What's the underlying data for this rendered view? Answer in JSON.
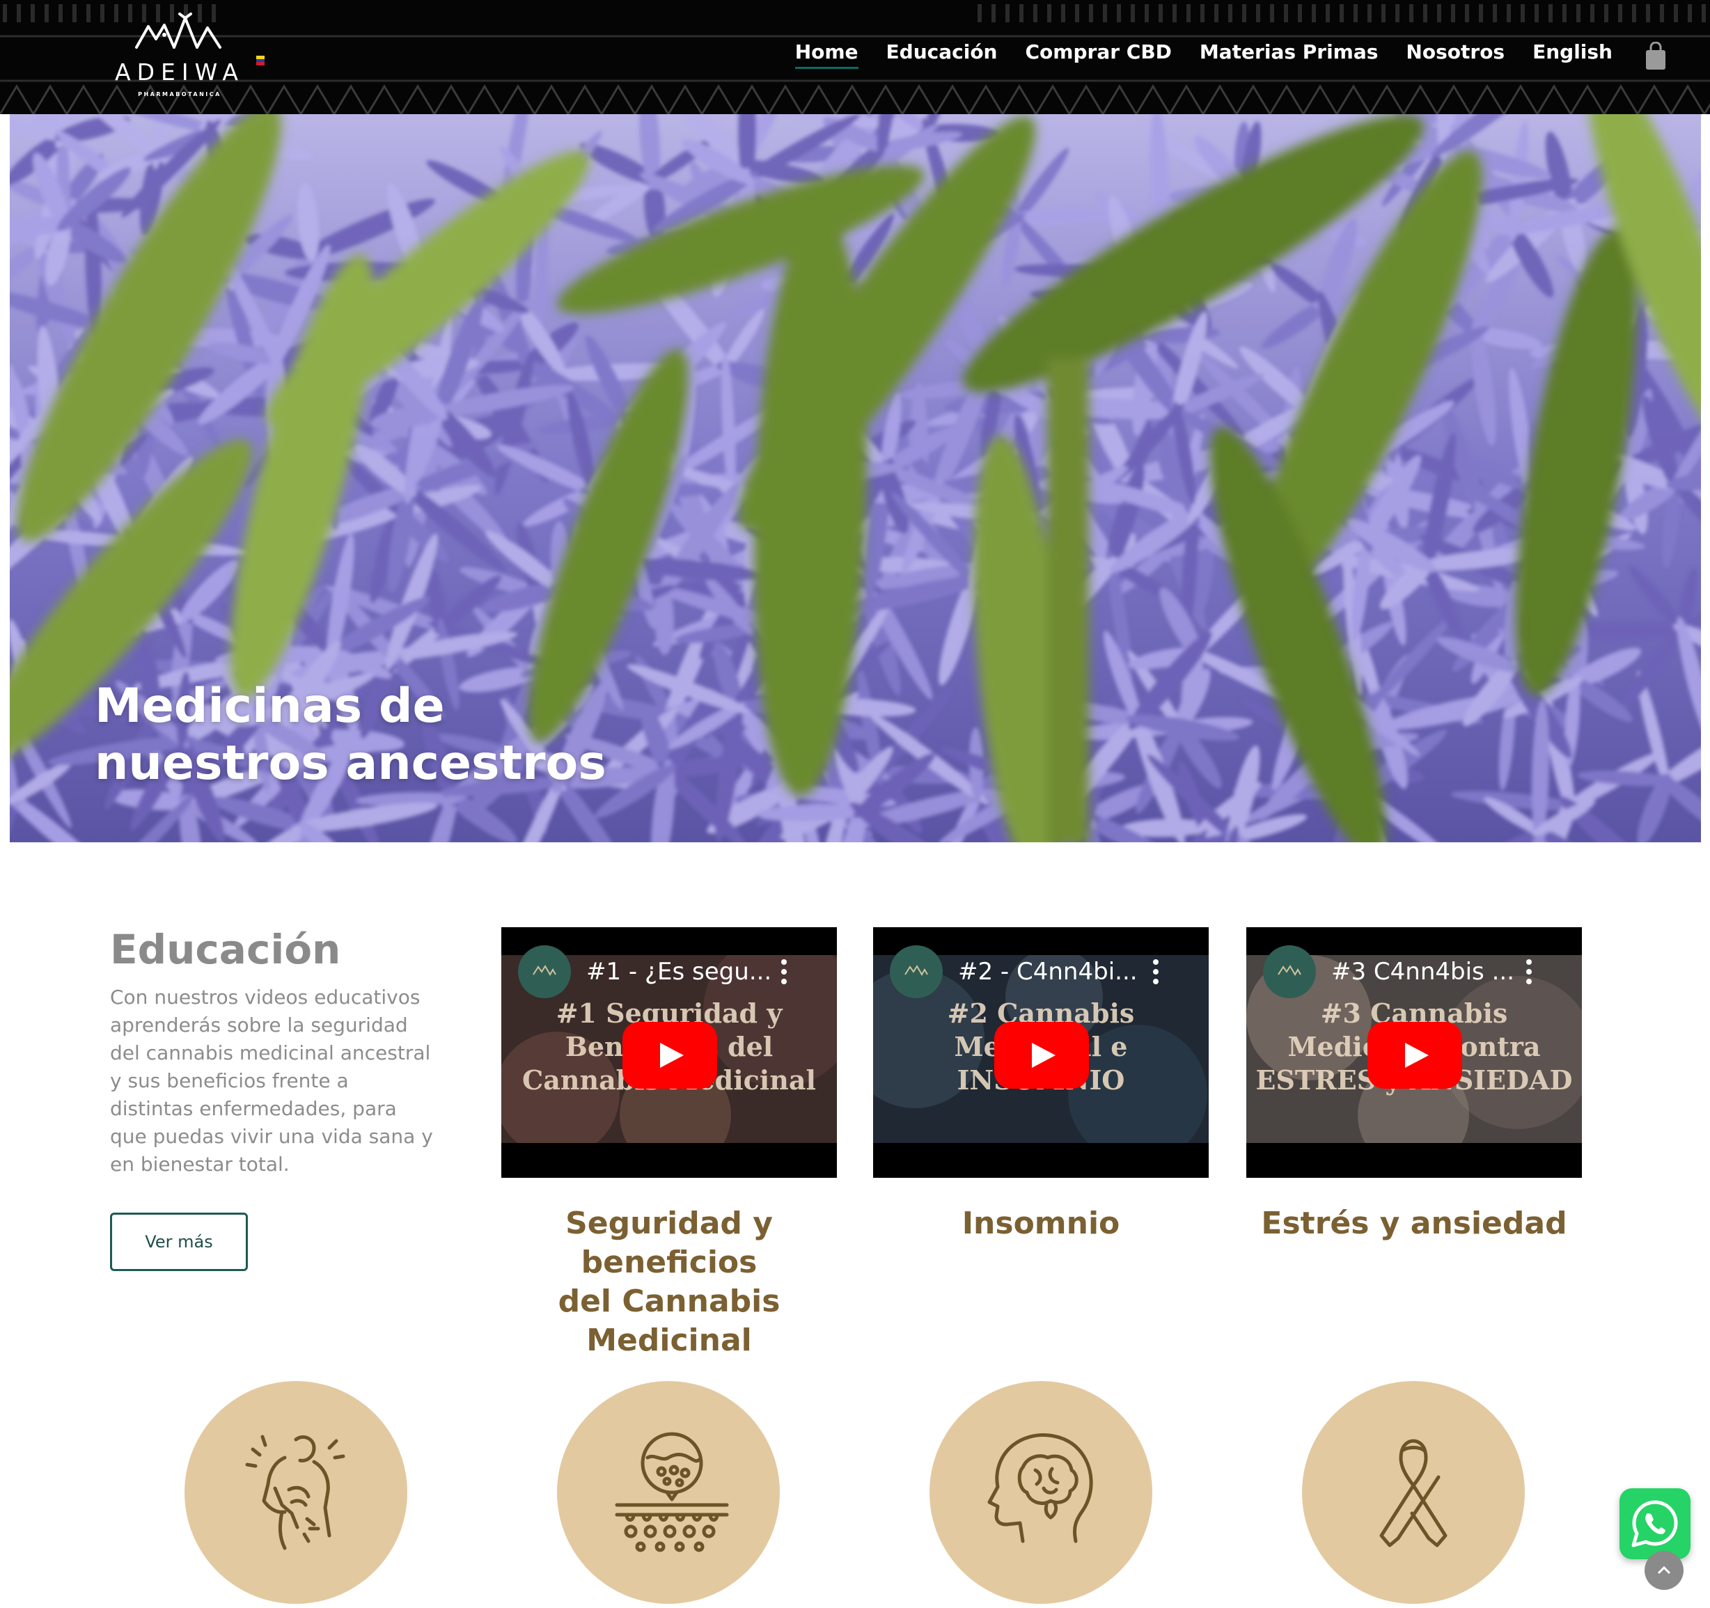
{
  "brand": {
    "name": "ADEIWA",
    "tagline": "PHARMABOTANICA"
  },
  "nav": {
    "items": [
      "Home",
      "Educación",
      "Comprar CBD",
      "Materias Primas",
      "Nosotros",
      "English"
    ],
    "active": "Home"
  },
  "hero": {
    "title_line1": "Medicinas de",
    "title_line2": "nuestros ancestros"
  },
  "education": {
    "title": "Educación",
    "text": "Con nuestros videos educativos aprenderás sobre la seguridad del cannabis medicinal ancestral y sus beneficios frente a distintas enfermedades, para que puedas vivir una vida sana y en bienestar total.",
    "button": "Ver más"
  },
  "videos": [
    {
      "title": "#1 - ¿Es segu...",
      "thumb_line1": "#1 Seguridad y",
      "thumb_line2": "Beneficios del",
      "thumb_line3": "Cannabis Medicinal",
      "caption_line1": "Seguridad y beneficios",
      "caption_line2": "del Cannabis Medicinal"
    },
    {
      "title": "#2 - C4nn4bi...",
      "thumb_line1": "#2 Cannabis",
      "thumb_line2": "Medicinal e",
      "thumb_line3": "INSOMNIO",
      "caption_line1": "Insomnio",
      "caption_line2": ""
    },
    {
      "title": "#3 C4nn4bis ...",
      "thumb_line1": "#3 Cannabis",
      "thumb_line2": "Medicinal contra",
      "thumb_line3": "ESTRES y ANSIEDAD",
      "caption_line1": "Estrés y ansiedad",
      "caption_line2": ""
    }
  ],
  "icons": [
    "back-pain-icon",
    "skin-icon",
    "brain-icon",
    "awareness-ribbon-icon",
    "whatsapp-icon",
    "cart-icon",
    "scroll-top-icon"
  ],
  "colors": {
    "header_bg": "#050505",
    "active_underline": "#0e6a62",
    "caption": "#7b6032",
    "circle": "#e3c9a0",
    "button_border": "#1f5a55",
    "whatsapp": "#25d366",
    "youtube_red": "#ff0000"
  }
}
